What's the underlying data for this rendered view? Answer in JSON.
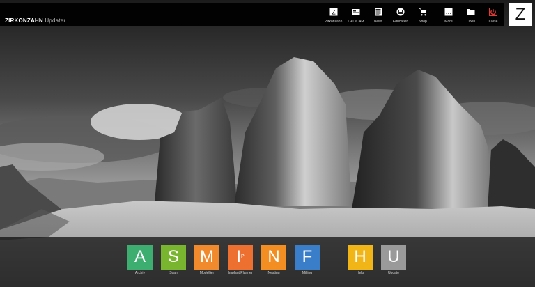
{
  "app": {
    "brand": "ZIRKONZAHN",
    "product": "Updater",
    "logo_letter": "Z"
  },
  "nav": {
    "items": [
      {
        "label": "Zirkonzahn",
        "icon": "z-box-icon"
      },
      {
        "label": "CAD/CAM",
        "icon": "card-icon"
      },
      {
        "label": "News",
        "icon": "newspaper-icon"
      },
      {
        "label": "Education",
        "icon": "education-icon"
      },
      {
        "label": "Shop",
        "icon": "cart-icon"
      }
    ],
    "actions": [
      {
        "label": "More",
        "icon": "more-icon"
      },
      {
        "label": "Open",
        "icon": "folder-icon"
      },
      {
        "label": "Close",
        "icon": "power-icon",
        "color": "#e53935"
      }
    ]
  },
  "tiles": [
    {
      "letter": "A",
      "label": "Archiv",
      "color": "#3dae6f"
    },
    {
      "letter": "S",
      "label": "Scan",
      "color": "#7ab530"
    },
    {
      "letter": "M",
      "label": "Modellier",
      "color": "#f08a2c"
    },
    {
      "letter": "I",
      "sub": "P",
      "label": "Implant Planner",
      "color": "#ee7031"
    },
    {
      "letter": "N",
      "label": "Nesting",
      "color": "#f38f22"
    },
    {
      "letter": "F",
      "label": "Milling",
      "color": "#3a7dc8"
    },
    {
      "letter": "H",
      "label": "Help",
      "color": "#f2b518"
    },
    {
      "letter": "U",
      "label": "Update",
      "color": "#9a9a9a"
    }
  ]
}
